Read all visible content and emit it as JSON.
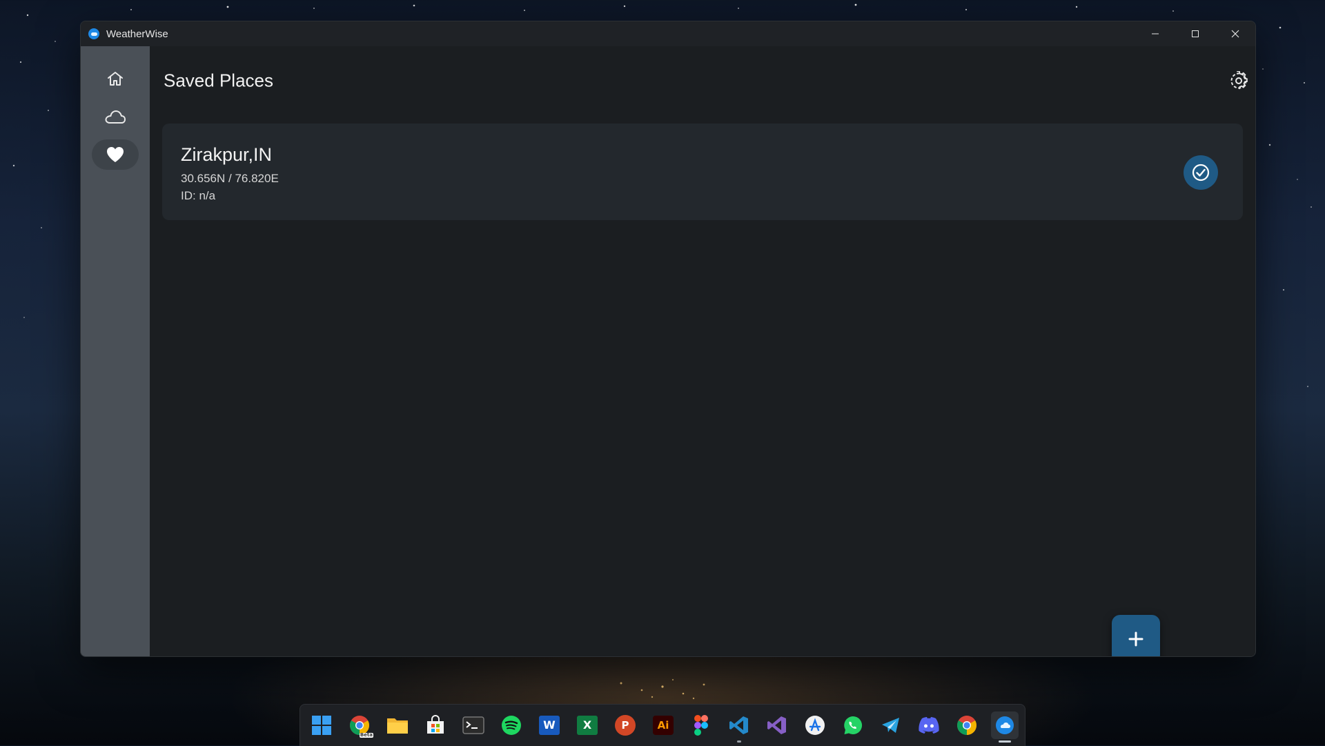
{
  "window": {
    "title": "WeatherWise",
    "accent": "#1f5a85"
  },
  "sidebar": {
    "items": [
      {
        "name": "home",
        "icon": "home-icon",
        "active": false
      },
      {
        "name": "weather",
        "icon": "cloud-icon",
        "active": false
      },
      {
        "name": "saved-places",
        "icon": "heart-icon",
        "active": true
      }
    ]
  },
  "page": {
    "title": "Saved Places",
    "settings_icon": "gear-icon"
  },
  "places": [
    {
      "name": "Zirakpur,IN",
      "coords": "30.656N / 76.820E",
      "id": "ID: n/a",
      "selected": true
    }
  ],
  "fab": {
    "icon": "plus-icon"
  },
  "taskbar": {
    "icons": [
      "windows-start-icon",
      "chrome-beta-icon",
      "file-explorer-icon",
      "microsoft-store-icon",
      "terminal-icon",
      "spotify-icon",
      "word-icon",
      "excel-icon",
      "powerpoint-icon",
      "illustrator-icon",
      "figma-icon",
      "vscode-icon",
      "visual-studio-icon",
      "app-store-icon",
      "whatsapp-icon",
      "telegram-icon",
      "discord-icon",
      "chrome-icon",
      "weatherwise-icon"
    ],
    "word_glyph": "W",
    "excel_glyph": "X",
    "powerpoint_glyph": "P",
    "illustrator_glyph": "Ai",
    "chrome_beta_badge": "Beta"
  }
}
